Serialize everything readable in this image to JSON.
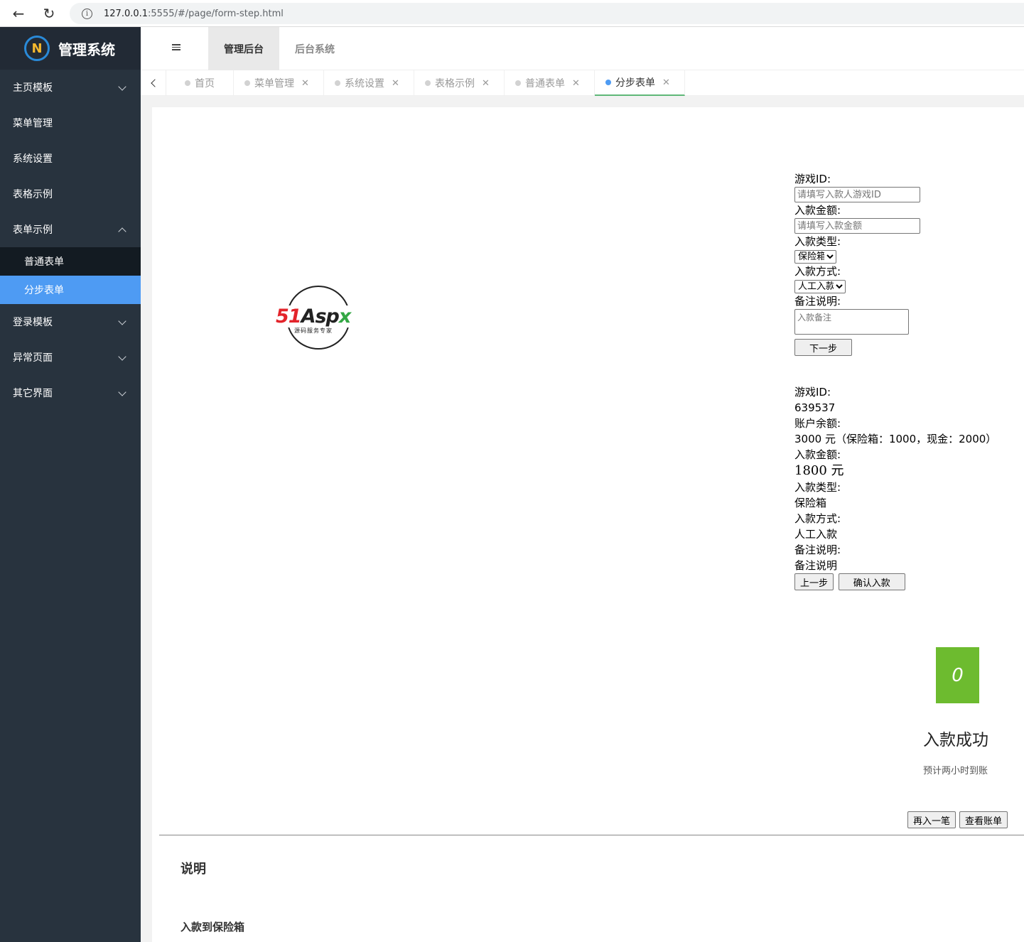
{
  "browser": {
    "url_host": "127.0.0.1",
    "url_rest": ":5555/#/page/form-step.html"
  },
  "sidebar": {
    "logo_text": "管理系统",
    "logo_letter": "N",
    "items": [
      {
        "label": "主页模板"
      },
      {
        "label": "菜单管理"
      },
      {
        "label": "系统设置"
      },
      {
        "label": "表格示例"
      },
      {
        "label": "表单示例"
      },
      {
        "label": "登录模板"
      },
      {
        "label": "异常页面"
      },
      {
        "label": "其它界面"
      }
    ],
    "sub_items": [
      {
        "label": "普通表单"
      },
      {
        "label": "分步表单"
      }
    ]
  },
  "header": {
    "tabs": [
      {
        "label": "管理后台"
      },
      {
        "label": "后台系统"
      }
    ]
  },
  "page_tabs": [
    {
      "label": "首页"
    },
    {
      "label": "菜单管理"
    },
    {
      "label": "系统设置"
    },
    {
      "label": "表格示例"
    },
    {
      "label": "普通表单"
    },
    {
      "label": "分步表单"
    }
  ],
  "brand": {
    "word_a": "51",
    "word_b": "Asp",
    "word_c": "x",
    "subtitle": "源码服务专家"
  },
  "step1": {
    "game_id_label": "游戏ID:",
    "game_id_placeholder": "请填写入款人游戏ID",
    "amount_label": "入款金额:",
    "amount_placeholder": "请填写入款金额",
    "type_label": "入款类型:",
    "type_value": "保险箱",
    "method_label": "入款方式:",
    "method_value": "人工入款",
    "remark_label": "备注说明:",
    "remark_placeholder": "入款备注",
    "next_button": "下一步"
  },
  "step2": {
    "game_id_label": "游戏ID:",
    "game_id_value": "639537",
    "balance_label": "账户余额:",
    "balance_value": "3000 元（保险箱：1000，现金：2000）",
    "amount_label": "入款金额:",
    "amount_value": "1800 元",
    "type_label": "入款类型:",
    "type_value": "保险箱",
    "method_label": "入款方式:",
    "method_value": "人工入款",
    "remark_label": "备注说明:",
    "remark_value": "备注说明",
    "prev_button": "上一步",
    "confirm_button": "确认入款"
  },
  "step3": {
    "icon_glyph": "0",
    "title": "入款成功",
    "subtitle": "预计两小时到账",
    "again_button": "再入一笔",
    "view_button": "查看账单"
  },
  "notes": {
    "title": "说明",
    "subtitle": "入款到保险箱"
  }
}
